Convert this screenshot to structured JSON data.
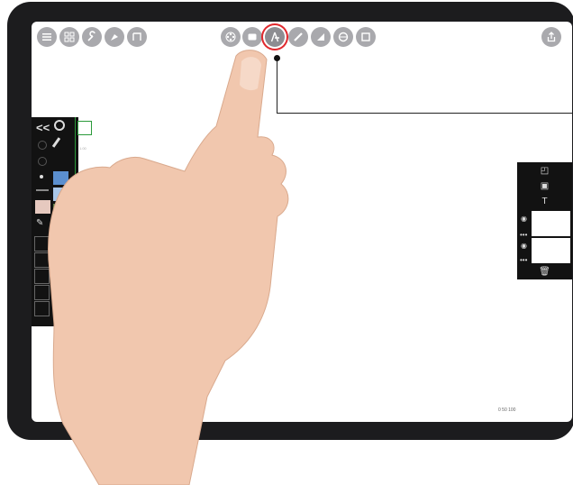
{
  "app": {
    "name": "sketch-app"
  },
  "toolbar_left": [
    {
      "icon": "gallery-icon"
    },
    {
      "icon": "grid-icon"
    },
    {
      "icon": "wrench-icon"
    },
    {
      "icon": "pen-nib-icon"
    },
    {
      "icon": "crop-icon"
    }
  ],
  "toolbar_center": [
    {
      "icon": "brush-wheel-icon"
    },
    {
      "icon": "rectangle-icon"
    },
    {
      "icon": "compass-icon",
      "active": true
    },
    {
      "icon": "ruler-icon"
    },
    {
      "icon": "triangle-icon"
    },
    {
      "icon": "ellipse-icon"
    },
    {
      "icon": "square-icon"
    }
  ],
  "toolbar_right": [
    {
      "icon": "share-icon"
    }
  ],
  "left_panel": {
    "collapse_label": "<<",
    "colors": [
      "#5b8fcf",
      "#a9c6e8",
      "#5c7f45",
      "#9fc27f",
      "#d9c27e",
      "#e8dcb3",
      "#cfcfcf",
      "#8b8b8b",
      "#e6c9bf"
    ],
    "size_marks": [
      "1.00",
      "0.50",
      "0.25",
      "0.10"
    ]
  },
  "right_panel": {
    "tools": [
      "new-layer-icon",
      "merge-icon",
      "text-layer-icon"
    ],
    "layers": [
      {
        "visible": true
      },
      {
        "visible": true
      }
    ]
  },
  "accent_color": "#e0282d",
  "scale_text": "0  50  100"
}
